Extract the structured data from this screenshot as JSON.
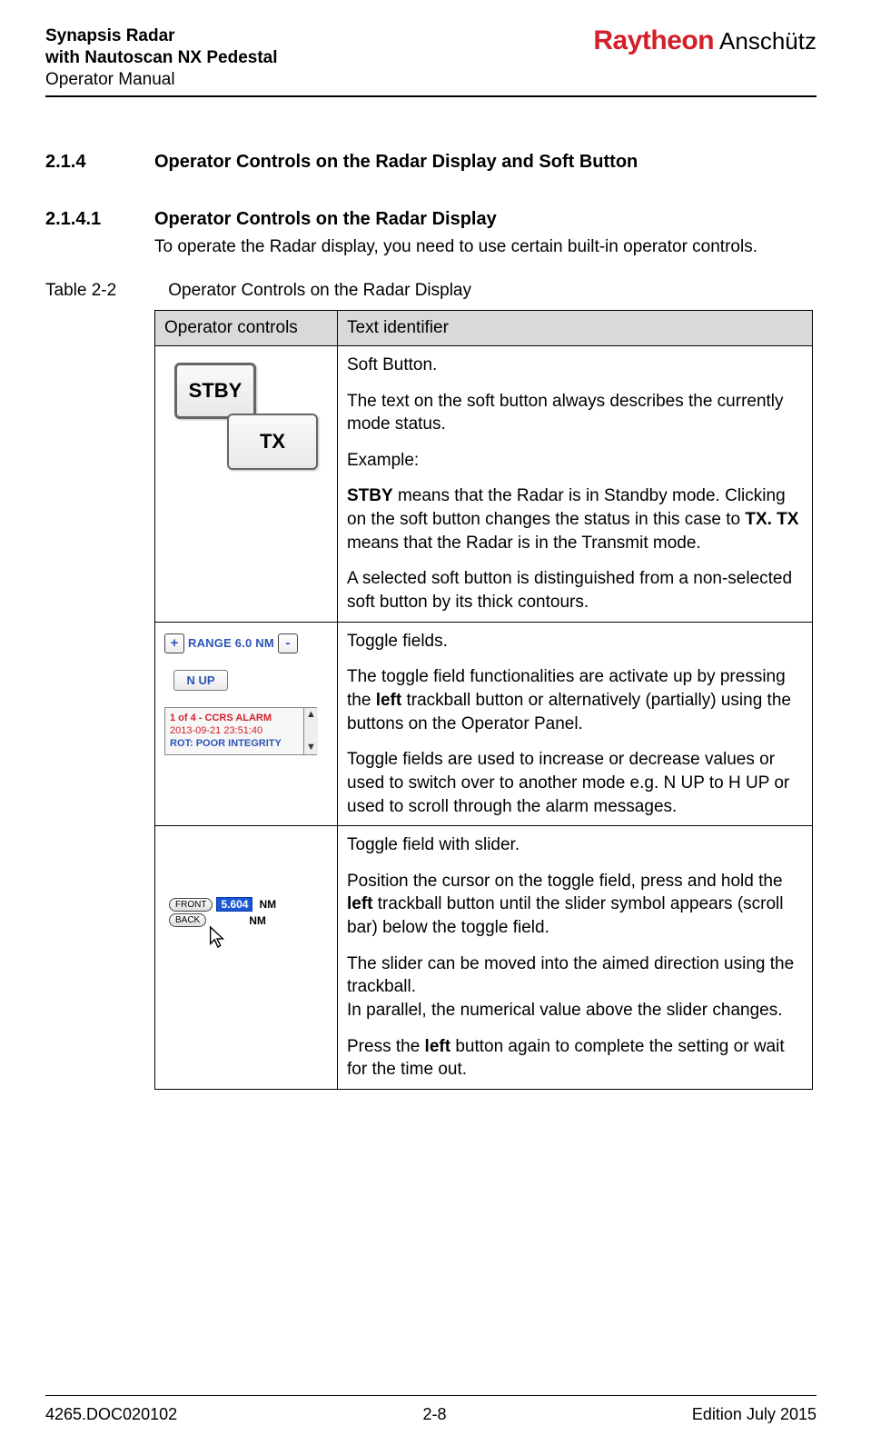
{
  "header": {
    "title_line1": "Synapsis Radar",
    "title_line2": "with Nautoscan NX Pedestal",
    "title_line3": "Operator Manual",
    "logo_main": "Raytheon",
    "logo_sub": "Anschütz"
  },
  "sections": {
    "s214": {
      "num": "2.1.4",
      "title": "Operator Controls on the Radar Display and Soft Button"
    },
    "s2141": {
      "num": "2.1.4.1",
      "title": "Operator Controls on the Radar Display",
      "body": "To operate the Radar display, you need to use certain built-in operator controls."
    }
  },
  "table_caption": {
    "num": "Table 2-2",
    "text": "Operator Controls on the Radar Display"
  },
  "table": {
    "head": {
      "col1": "Operator controls",
      "col2": "Text identifier"
    },
    "row1": {
      "fig": {
        "stby": "STBY",
        "tx": "TX"
      },
      "p1": "Soft Button.",
      "p2": "The text on the soft button always describes the currently mode status.",
      "p3": "Example:",
      "p4a": "STBY",
      "p4b": " means that the Radar is in Standby mode. Clicking on the soft button changes the status in this case to ",
      "p4c": "TX. TX",
      "p4d": " means that the Radar is in the Transmit mode.",
      "p5": "A selected soft button is distinguished from a non-selected soft button by its thick contours."
    },
    "row2": {
      "fig": {
        "plus": "+",
        "minus": "-",
        "range": "RANGE 6.0 NM",
        "nup": "N UP",
        "alarm_l1": "1 of 4 - CCRS ALARM",
        "alarm_l2": "2013-09-21 23:51:40",
        "alarm_l3": "ROT: POOR INTEGRITY"
      },
      "p1": "Toggle fields.",
      "p2a": "The toggle field functionalities are activate up by pressing the ",
      "p2b": "left",
      "p2c": " trackball button or alternatively (partially) using the buttons on the Operator Panel.",
      "p3": "Toggle fields are used to increase or decrease values or used to switch over to another mode e.g. N UP to H UP or used to scroll through the alarm messages."
    },
    "row3": {
      "fig": {
        "front": "FRONT",
        "back": "BACK",
        "val": "5.604",
        "unit": "NM"
      },
      "p1": "Toggle field with slider.",
      "p2a": "Position the cursor on the toggle field, press and hold the ",
      "p2b": "left",
      "p2c": " trackball button until the slider symbol appears (scroll bar) below the toggle field.",
      "p3": "The slider can be moved into the aimed direction using the trackball.",
      "p3b": "In parallel, the numerical value above the slider changes.",
      "p4a": "Press the ",
      "p4b": "left",
      "p4c": " button again to complete the setting or wait for the time out."
    }
  },
  "footer": {
    "doc_id": "4265.DOC020102",
    "page": "2-8",
    "edition": "Edition July 2015"
  }
}
